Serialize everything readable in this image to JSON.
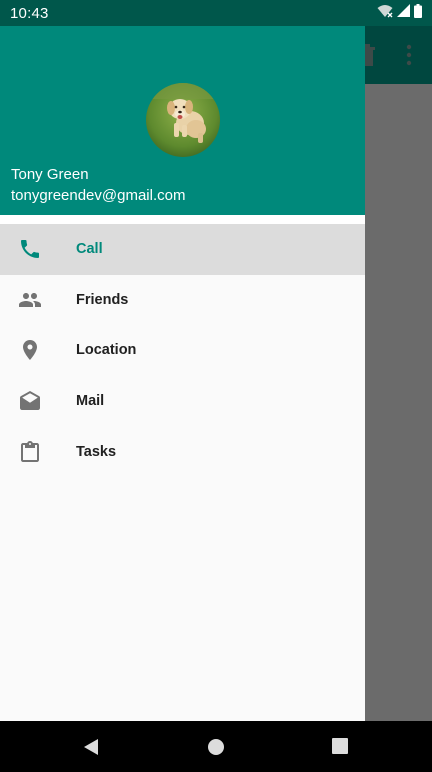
{
  "status_bar": {
    "time": "10:43"
  },
  "drawer": {
    "header": {
      "name": "Tony Green",
      "email": "tonygreendev@gmail.com"
    },
    "items": [
      {
        "label": "Call",
        "icon": "phone-icon",
        "selected": true
      },
      {
        "label": "Friends",
        "icon": "people-icon",
        "selected": false
      },
      {
        "label": "Location",
        "icon": "location-pin-icon",
        "selected": false
      },
      {
        "label": "Mail",
        "icon": "mail-icon",
        "selected": false
      },
      {
        "label": "Tasks",
        "icon": "clipboard-icon",
        "selected": false
      }
    ]
  },
  "colors": {
    "status_bar": "#00574b",
    "header": "#00897b",
    "accent": "#00897b",
    "selected_bg": "#dcdcdc",
    "scrim": "#6b6b6b"
  }
}
